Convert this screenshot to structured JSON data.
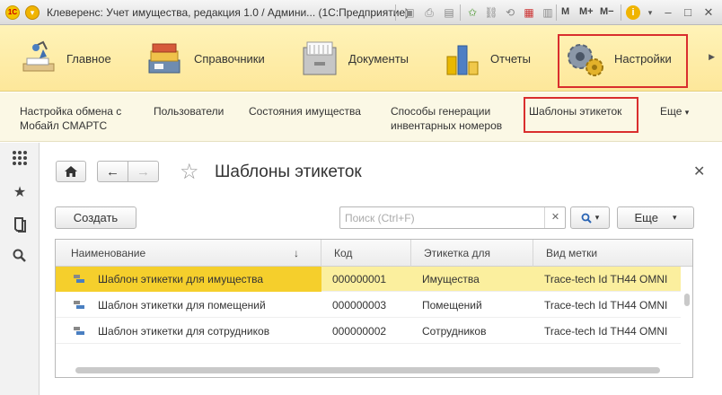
{
  "titlebar": {
    "title": "Клеверенс: Учет имущества, редакция 1.0 / Админи... (1С:Предприятие)",
    "m_label": "M",
    "mplus_label": "M+",
    "mminus_label": "M−"
  },
  "sections": {
    "items": [
      {
        "label": "Главное",
        "icon": "home-desk-icon"
      },
      {
        "label": "Справочники",
        "icon": "folders-icon"
      },
      {
        "label": "Документы",
        "icon": "cabinet-icon"
      },
      {
        "label": "Отчеты",
        "icon": "bar-chart-icon"
      },
      {
        "label": "Настройки",
        "icon": "gears-icon",
        "active": true
      }
    ]
  },
  "functions": {
    "items": [
      {
        "line1": "Настройка обмена с",
        "line2": "Мобайл СМАРТС"
      },
      {
        "line1": "Пользователи",
        "line2": ""
      },
      {
        "line1": "Состояния имущества",
        "line2": ""
      },
      {
        "line1": "Способы генерации",
        "line2": "инвентарных номеров"
      },
      {
        "line1": "Шаблоны этикеток",
        "line2": ""
      }
    ],
    "more_label": "Еще"
  },
  "form": {
    "title": "Шаблоны этикеток",
    "create_label": "Создать",
    "search_placeholder": "Поиск (Ctrl+F)",
    "more_label": "Еще",
    "columns": [
      "Наименование",
      "Код",
      "Этикетка для",
      "Вид метки"
    ],
    "sort_indicator": "↓",
    "rows": [
      {
        "name": "Шаблон этикетки для имущества",
        "code": "000000001",
        "label_for": "Имущества",
        "mark_type": "Trace-tech Id TH44 OMNI"
      },
      {
        "name": "Шаблон этикетки для помещений",
        "code": "000000003",
        "label_for": "Помещений",
        "mark_type": "Trace-tech Id TH44 OMNI"
      },
      {
        "name": "Шаблон этикетки для сотрудников",
        "code": "000000002",
        "label_for": "Сотрудников",
        "mark_type": "Trace-tech Id TH44 OMNI"
      }
    ]
  },
  "colors": {
    "highlight_border": "#d92e2e",
    "selected_row": "#fbef9e",
    "selected_cell": "#f5cf2c",
    "sections_bg": "#fde79a"
  }
}
